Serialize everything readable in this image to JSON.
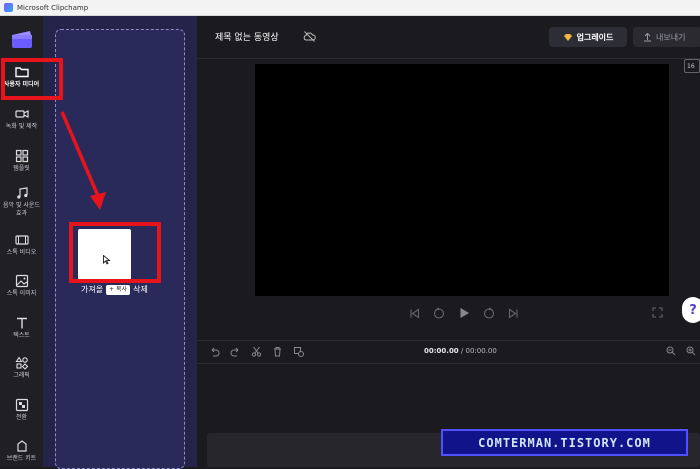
{
  "window": {
    "title": "Microsoft Clipchamp"
  },
  "sidebar": {
    "items": [
      {
        "label": "사용자 미디어",
        "icon": "folder-icon",
        "active": true
      },
      {
        "label": "녹화 및 제작",
        "icon": "camera-icon"
      },
      {
        "label": "템플릿",
        "icon": "templates-icon"
      },
      {
        "label": "음악 및 사운드 효과",
        "icon": "music-icon"
      },
      {
        "label": "스톡 비디오",
        "icon": "film-icon"
      },
      {
        "label": "스톡 이미지",
        "icon": "image-icon"
      },
      {
        "label": "텍스트",
        "icon": "text-icon"
      },
      {
        "label": "그래픽",
        "icon": "shapes-icon"
      },
      {
        "label": "전환",
        "icon": "transition-icon"
      },
      {
        "label": "브랜드 키트",
        "icon": "brand-kit-icon"
      }
    ]
  },
  "media_panel": {
    "drop_caption_left": "가져올",
    "copy_badge": "+ 복사",
    "drop_caption_right": "삭제"
  },
  "header": {
    "project_title": "제목 없는 동영상",
    "upgrade_label": "업그레이드",
    "export_label": "내보내기",
    "aspect_ratio": "16"
  },
  "timeline": {
    "current_time": "00:00.00",
    "total_time": "/ 00:00.00"
  },
  "watermark": "COMTERMAN.TISTORY.COM",
  "colors": {
    "highlight": "#e8141b",
    "panel": "#24244a",
    "accent": "#5a3fcf"
  }
}
